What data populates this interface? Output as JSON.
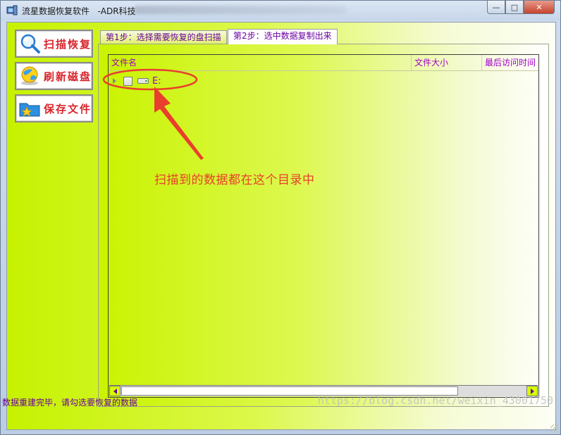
{
  "window": {
    "title": "流星数据恢复软件   -ADR科技",
    "minimize_label": "—",
    "maximize_label": "□",
    "close_label": "✕"
  },
  "sidebar": {
    "buttons": [
      {
        "label": "扫描恢复",
        "icon": "magnifier-icon"
      },
      {
        "label": "刷新磁盘",
        "icon": "globe-refresh-icon"
      },
      {
        "label": "保存文件",
        "icon": "save-folder-icon"
      }
    ]
  },
  "tabs": [
    {
      "label": "第1步：选择需要恢复的盘扫描",
      "active": false
    },
    {
      "label": "第2步：选中数据复制出来",
      "active": true
    }
  ],
  "file_list": {
    "columns": [
      "文件名",
      "文件大小",
      "最后访问时间"
    ],
    "rows": [
      {
        "name": "E:",
        "checked": false,
        "expanded": false
      }
    ]
  },
  "annotation": {
    "text": "扫描到的数据都在这个目录中",
    "color": "#e8402c"
  },
  "status": {
    "message": "数据重建完毕，请勾选要恢复的数据"
  },
  "watermark": "https://blog.csdn.net/weixin_43001750",
  "colors": {
    "accent_text": "#a000c8",
    "button_text": "#d9242c",
    "background_start": "#c6f200",
    "background_end": "#ffffff"
  }
}
